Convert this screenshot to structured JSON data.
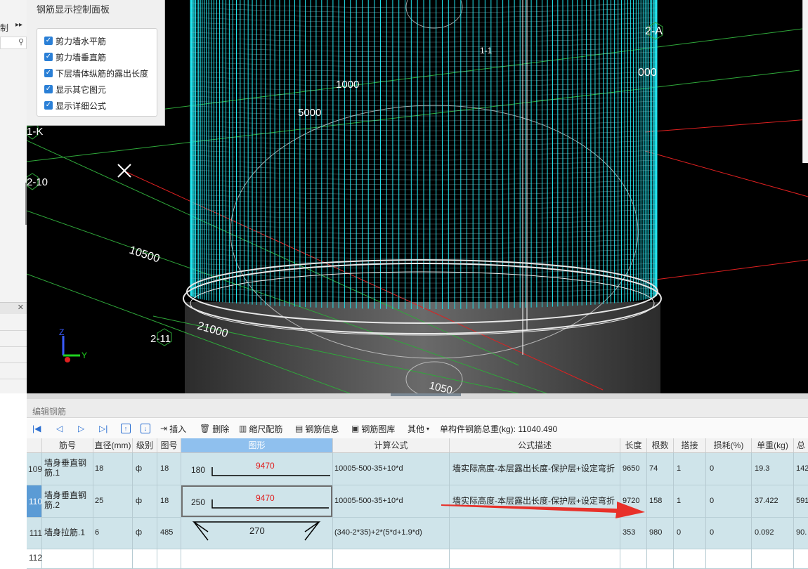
{
  "left_panel": {
    "tab_label": "制",
    "more_icon": "double-chevron-right",
    "search_icon": "magnifier"
  },
  "viewport": {
    "labels": {
      "axis_2A": "2-A",
      "axis_1K": "1-K",
      "axis_2_10": "2-10",
      "axis_2_11": "2-11",
      "dim_1000": "1000",
      "dim_5000": "5000",
      "dim_10500": "10500",
      "dim_21000": "21000",
      "dim_10500_b": "1050",
      "dim_right": "000",
      "top_small": "1-1"
    },
    "triad": {
      "z": "Z",
      "y": "Y"
    },
    "colors": {
      "rebar": "#1fe6f0",
      "grid": "#2fa83a",
      "axis_red": "#e02020",
      "ring": "#e8e8e8"
    }
  },
  "control_panel": {
    "title": "钢筋显示控制面板",
    "options": [
      {
        "label": "剪力墙水平筋",
        "checked": true
      },
      {
        "label": "剪力墙垂直筋",
        "checked": true
      },
      {
        "label": "下层墙体纵筋的露出长度",
        "checked": true
      },
      {
        "label": "显示其它图元",
        "checked": true
      },
      {
        "label": "显示详细公式",
        "checked": true
      }
    ]
  },
  "editor": {
    "title": "编辑钢筋",
    "toolbar": {
      "insert": "插入",
      "delete": "删除",
      "scale": "缩尺配筋",
      "info": "钢筋信息",
      "library": "钢筋图库",
      "other": "其他",
      "total_label": "单构件钢筋总重(kg): 11040.490"
    },
    "columns": [
      "筋号",
      "直径(mm)",
      "级别",
      "图号",
      "图形",
      "计算公式",
      "公式描述",
      "长度",
      "根数",
      "搭接",
      "损耗(%)",
      "单重(kg)",
      "总"
    ],
    "rows": [
      {
        "num": "109",
        "name": "墙身垂直钢筋.1",
        "diameter": "18",
        "grade": "ф",
        "fig": "18",
        "shape_left": "180",
        "shape_top": "9470",
        "formula": "10005-500-35+10*d",
        "desc": "墙实际高度-本层露出长度-保护层+设定弯折",
        "length": "9650",
        "count": "74",
        "lap": "1",
        "loss": "0",
        "unit_weight": "19.3",
        "total": "142"
      },
      {
        "num": "110",
        "name": "墙身垂直钢筋.2",
        "diameter": "25",
        "grade": "ф",
        "fig": "18",
        "shape_left": "250",
        "shape_top": "9470",
        "formula": "10005-500-35+10*d",
        "desc": "墙实际高度-本层露出长度-保护层+设定弯折",
        "length": "9720",
        "count": "158",
        "lap": "1",
        "loss": "0",
        "unit_weight": "37.422",
        "total": "591"
      },
      {
        "num": "111",
        "name": "墙身拉筋.1",
        "diameter": "6",
        "grade": "ф",
        "fig": "485",
        "shape_mid": "270",
        "formula": "(340-2*35)+2*(5*d+1.9*d)",
        "desc": "",
        "length": "353",
        "count": "980",
        "lap": "0",
        "loss": "0",
        "unit_weight": "0.092",
        "total": "90."
      },
      {
        "num": "112"
      }
    ]
  }
}
